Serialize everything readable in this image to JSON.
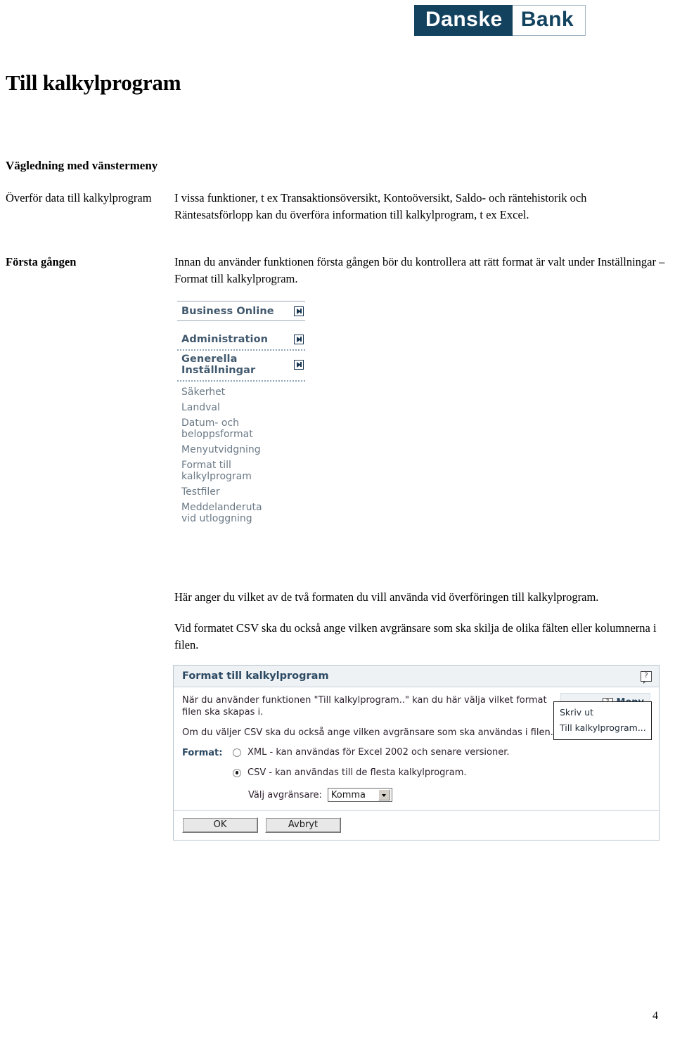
{
  "brand": {
    "logo_primary": "Danske",
    "logo_secondary": "Bank",
    "navy": "#13425f"
  },
  "document": {
    "title": "Till kalkylprogram",
    "section_heading": "Vägledning med vänstermeny",
    "page_number": "4"
  },
  "rows": [
    {
      "label": "Överför data till\nkalkylprogram",
      "bold": false,
      "body": "I vissa funktioner, t ex Transaktionsöversikt, Kontoöversikt, Saldo- och räntehistorik och Räntesatsförlopp kan du överföra information till kalkylprogram, t ex Excel."
    },
    {
      "label": "Första gången",
      "bold": true,
      "body": "Innan du använder funktionen första gången bör du kontrollera att rätt format är valt under Inställningar – Format till kalkylprogram."
    }
  ],
  "paragraphs": {
    "har_anger": "Här anger du vilket av de två formaten du vill använda vid överföringen till kalkylprogram.",
    "vid_formatet": "Vid formatet CSV ska du också ange vilken avgränsare som ska skilja de olika fälten eller kolumnerna i filen."
  },
  "menu_screenshot": {
    "headers": [
      {
        "label": "Business Online",
        "icon": "arrow-right-icon"
      },
      {
        "label": "Administration",
        "icon": "arrow-right-icon"
      },
      {
        "label": "Generella\nInställningar",
        "icon": "arrow-right-icon"
      }
    ],
    "items": [
      "Säkerhet",
      "Landval",
      "Datum- och\nbeloppsformat",
      "Menyutvidgning",
      "Format till\nkalkylprogram",
      "Testfiler",
      "Meddelanderuta\nvid utloggning"
    ]
  },
  "dialog": {
    "title": "Format till kalkylprogram",
    "help_glyph": "?",
    "body_paragraphs": [
      "När du använder funktionen \"Till kalkylprogram..\" kan du här välja vilket format filen ska skapas i.",
      "Om du väljer CSV ska du också ange vilken avgränsare som ska användas i filen."
    ],
    "format_label": "Format:",
    "options": [
      {
        "label": "XML - kan användas för Excel 2002 och senare versioner.",
        "selected": false
      },
      {
        "label": "CSV - kan användas till de flesta kalkylprogram.",
        "selected": true
      }
    ],
    "delimiter": {
      "label": "Välj avgränsare:",
      "value": "Komma"
    },
    "buttons": {
      "ok": "OK",
      "cancel": "Avbryt"
    },
    "meny_button": {
      "label": "Meny",
      "help_glyph": "?"
    },
    "popup_items": [
      "Skriv ut",
      "Till kalkylprogram..."
    ]
  }
}
